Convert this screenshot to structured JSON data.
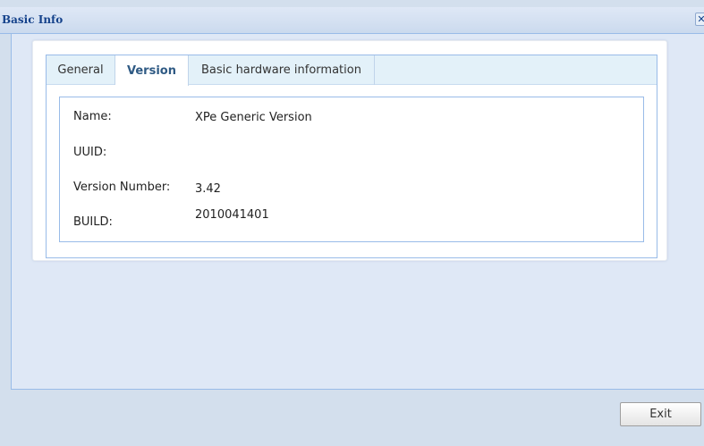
{
  "window": {
    "title": "Basic Info",
    "close_glyph": "✕"
  },
  "tabs": [
    {
      "label": "General",
      "active": false
    },
    {
      "label": "Version",
      "active": true
    },
    {
      "label": "Basic hardware information",
      "active": false
    }
  ],
  "version_info": {
    "name_label": "Name:",
    "name_value": "XPe Generic Version",
    "uuid_label": "UUID:",
    "uuid_value": "",
    "version_label": "Version Number:",
    "version_value": "3.42",
    "build_label": "BUILD:",
    "build_value": "2010041401"
  },
  "footer": {
    "exit_label": "Exit"
  },
  "icons": {
    "close": "close-icon"
  }
}
